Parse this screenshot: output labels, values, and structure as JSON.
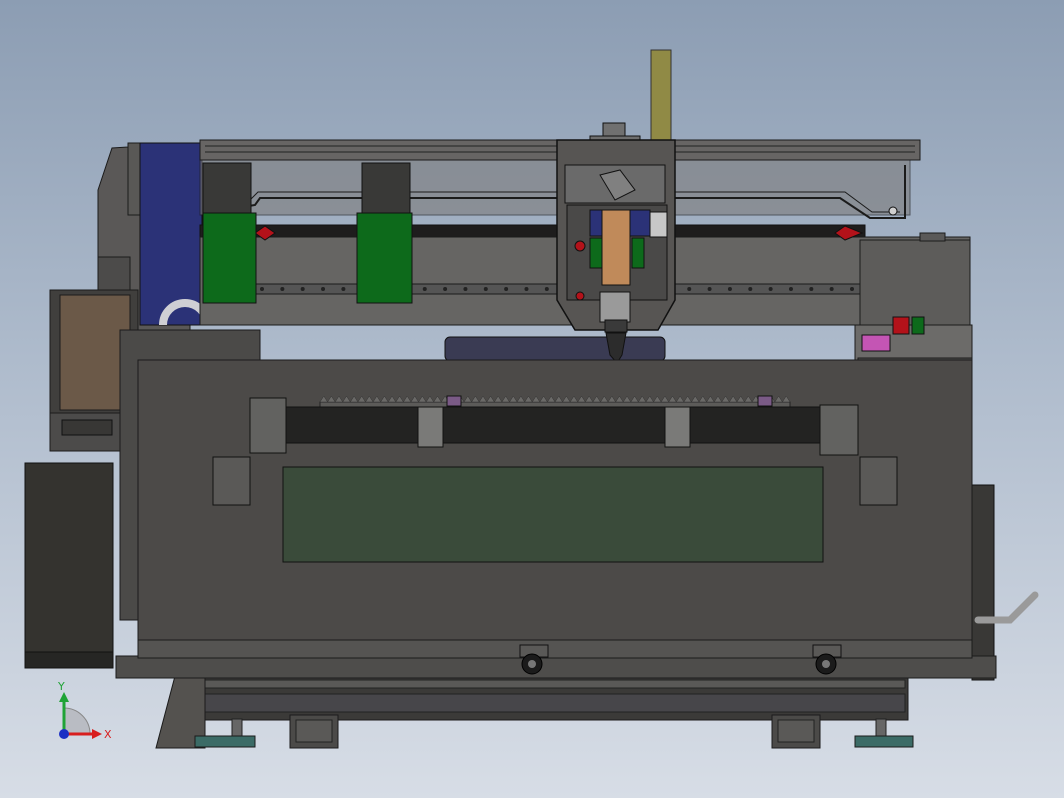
{
  "viewport": {
    "background_top": "#8c9db3",
    "background_bottom": "#d7dde6"
  },
  "triad": {
    "x_label": "X",
    "y_label": "Y",
    "x_color": "#d81e1e",
    "y_color": "#1fa336",
    "z_color": "#1b2fc4"
  },
  "model_colors": {
    "frame": "#4c4a48",
    "frame_dark": "#34332f",
    "motor_block": "#393937",
    "green_panel": "#0d6a1b",
    "bed_green": "#3a4b3a",
    "blue_panel": "#2b3277",
    "tan_block": "#6b5948",
    "orange": "#c08a5a",
    "yellow_pole": "#908a45",
    "tube": "#3a3b53",
    "red_tip": "#b3121a",
    "pink": "#c455b4",
    "teal_foot": "#3b6b66"
  },
  "rack_teeth_count": 62,
  "rail_bolt_count": 30
}
